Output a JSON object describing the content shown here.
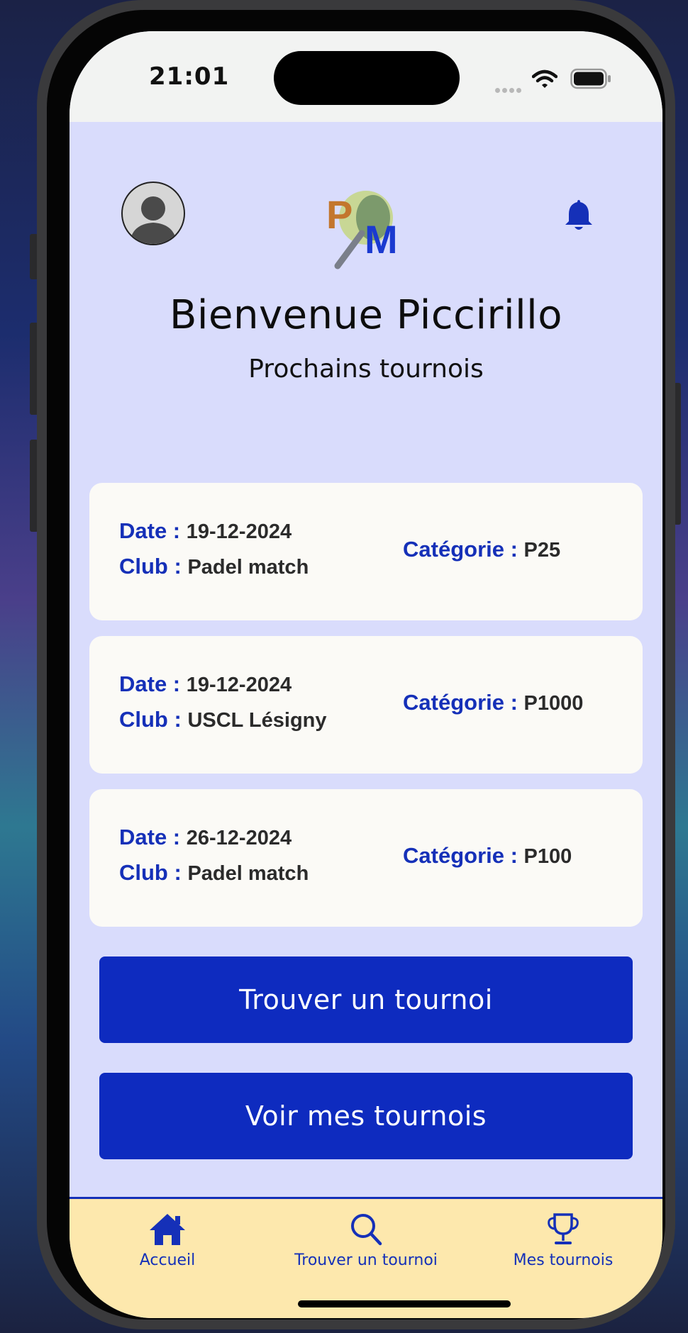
{
  "status_bar": {
    "time": "21:01"
  },
  "header": {
    "avatar": "avatar-placeholder",
    "logo_letters": {
      "first": "P",
      "second": "M"
    },
    "notification_icon": "bell-icon"
  },
  "welcome": {
    "title": "Bienvenue Piccirillo",
    "subtitle": "Prochains tournois"
  },
  "tournaments": [
    {
      "date_label": "Date :",
      "date": "19-12-2024",
      "club_label": "Club :",
      "club": "Padel match",
      "category_label": "Catégorie :",
      "category": "P25"
    },
    {
      "date_label": "Date :",
      "date": "19-12-2024",
      "club_label": "Club :",
      "club": "USCL Lésigny",
      "category_label": "Catégorie :",
      "category": "P1000"
    },
    {
      "date_label": "Date :",
      "date": "26-12-2024",
      "club_label": "Club :",
      "club": "Padel match",
      "category_label": "Catégorie :",
      "category": "P100"
    }
  ],
  "actions": {
    "find": "Trouver un tournoi",
    "mine": "Voir mes tournois"
  },
  "tabbar": [
    {
      "label": "Accueil",
      "icon": "home-icon"
    },
    {
      "label": "Trouver un tournoi",
      "icon": "search-icon"
    },
    {
      "label": "Mes tournois",
      "icon": "trophy-icon"
    }
  ],
  "colors": {
    "accent": "#0e2bbf",
    "background": "#d9dcfc",
    "card": "#fbfaf6",
    "tabbar": "#fde8ad",
    "label": "#1530b8"
  }
}
